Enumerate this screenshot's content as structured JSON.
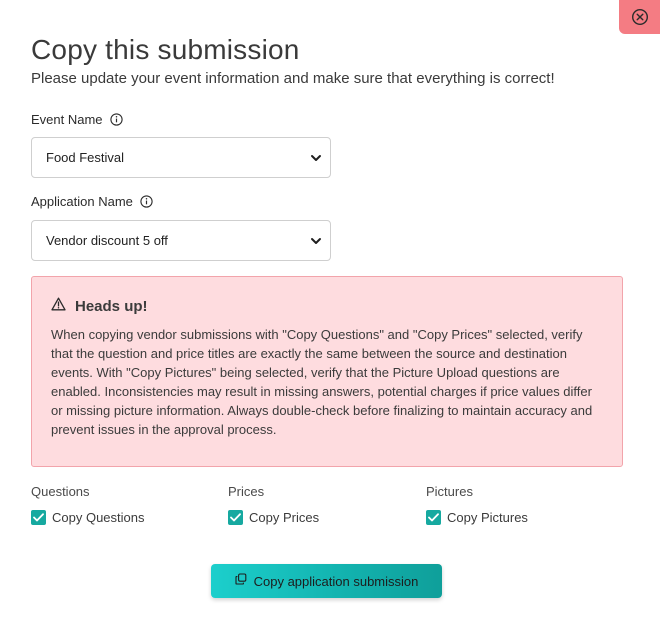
{
  "dialog": {
    "title": "Copy this submission",
    "subtitle": "Please update your event information and make sure that everything is correct!"
  },
  "fields": {
    "event_name": {
      "label": "Event Name",
      "value": "Food Festival"
    },
    "application_name": {
      "label": "Application Name",
      "value": "Vendor discount 5 off"
    }
  },
  "alert": {
    "title": "Heads up!",
    "body": "When copying vendor submissions with \"Copy Questions\" and \"Copy Prices\" selected, verify that the question and price titles are exactly the same between the source and destination events. With \"Copy Pictures\" being selected, verify that the Picture Upload questions are enabled. Inconsistencies may result in missing answers, potential charges if price values differ or missing picture information. Always double-check before finalizing to maintain accuracy and prevent issues in the approval process."
  },
  "options": {
    "questions": {
      "heading": "Questions",
      "label": "Copy Questions",
      "checked": true
    },
    "prices": {
      "heading": "Prices",
      "label": "Copy Prices",
      "checked": true
    },
    "pictures": {
      "heading": "Pictures",
      "label": "Copy Pictures",
      "checked": true
    }
  },
  "actions": {
    "submit_label": "Copy application submission"
  },
  "icons": {
    "close": "close-circle-icon",
    "info": "info-icon",
    "chevron": "chevron-down-icon",
    "warning": "warning-triangle-icon",
    "checkmark": "checkmark-icon",
    "copy": "copy-icon"
  },
  "colors": {
    "close_bg": "#f47c83",
    "alert_bg": "#fedcdf",
    "alert_border": "#f2a4ab",
    "checkbox": "#16a9a0",
    "button_start": "#1ccfcc",
    "button_end": "#0f9f9a"
  }
}
